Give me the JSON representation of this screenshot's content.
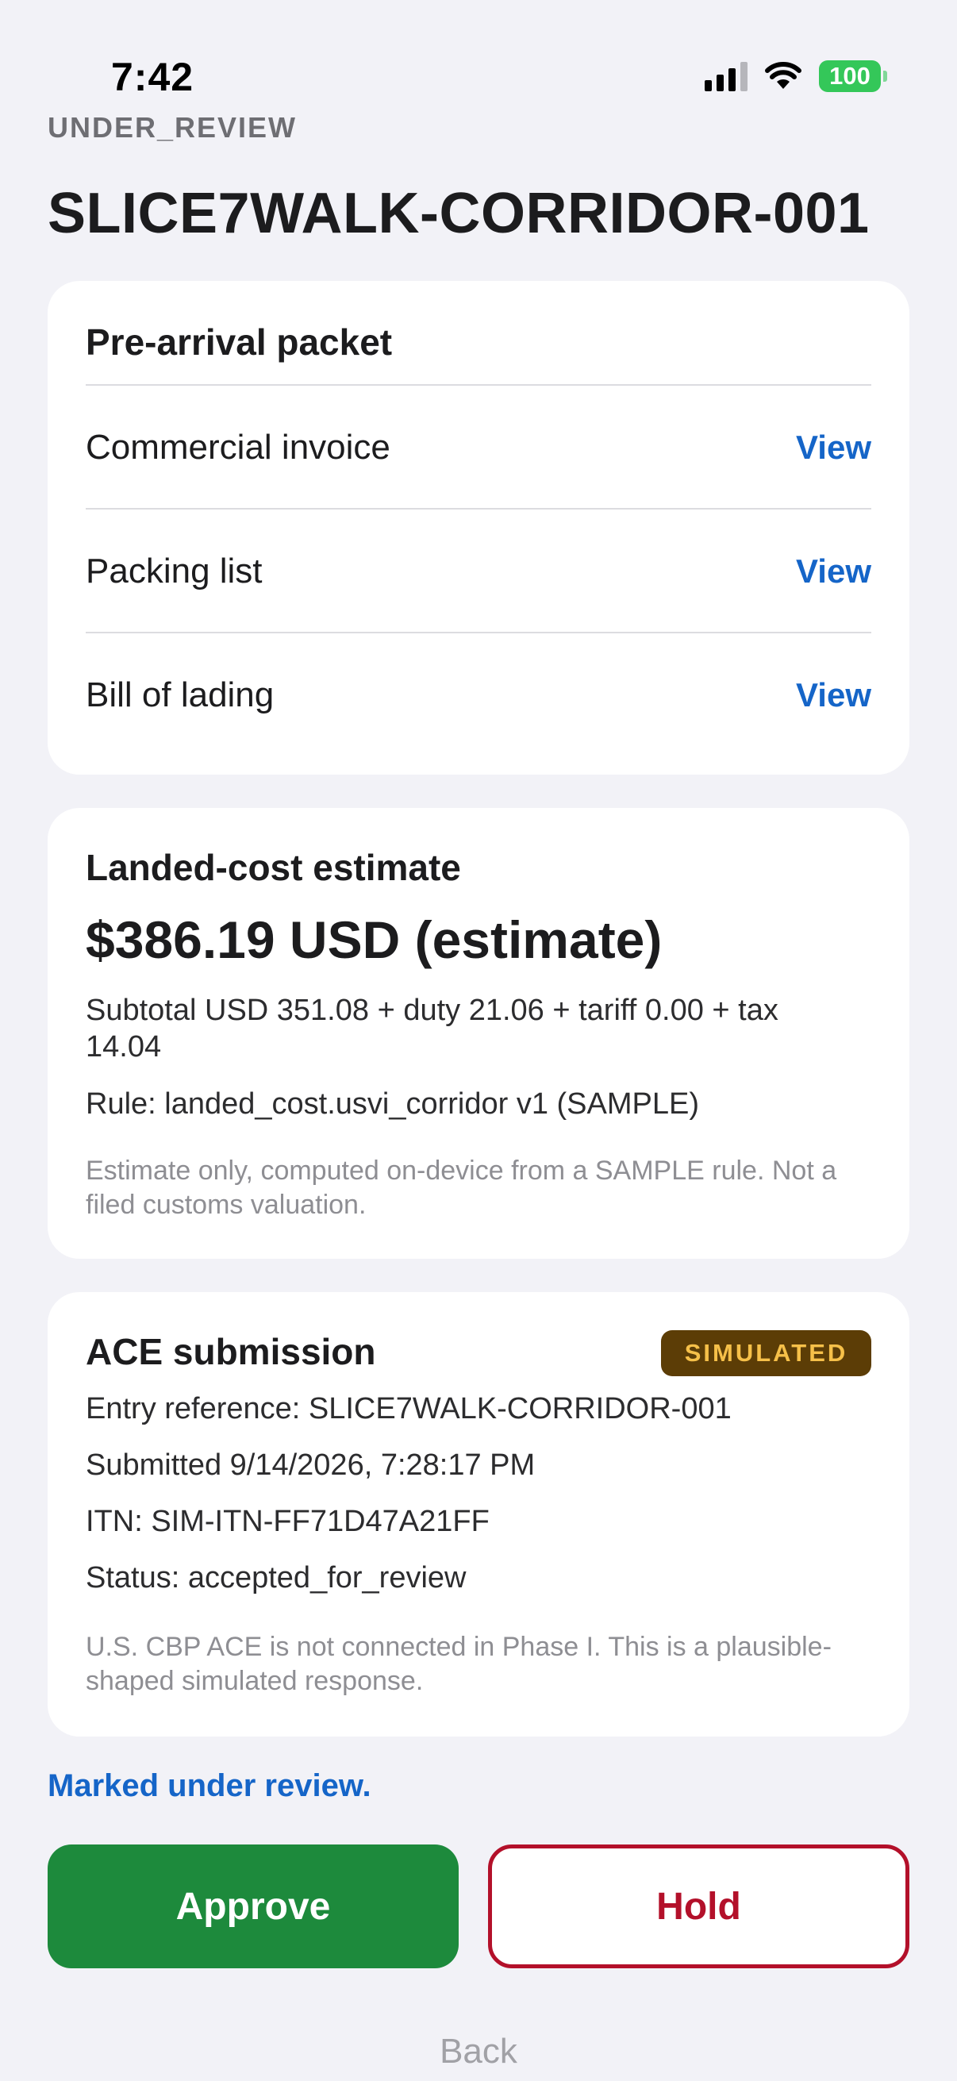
{
  "status_bar": {
    "time": "7:42",
    "battery": "100"
  },
  "header": {
    "status_label": "UNDER_REVIEW",
    "title": "SLICE7WALK-CORRIDOR-001"
  },
  "packet": {
    "title": "Pre-arrival packet",
    "view_label": "View",
    "documents": [
      {
        "label": "Commercial invoice"
      },
      {
        "label": "Packing list"
      },
      {
        "label": "Bill of lading"
      }
    ]
  },
  "landed_cost": {
    "title": "Landed-cost estimate",
    "amount": "$386.19 USD (estimate)",
    "breakdown": "Subtotal USD 351.08 + duty 21.06 + tariff 0.00 + tax 14.04",
    "rule": "Rule: landed_cost.usvi_corridor v1 (SAMPLE)",
    "note": "Estimate only, computed on-device from a SAMPLE rule. Not a filed customs valuation."
  },
  "ace": {
    "title": "ACE submission",
    "badge": "SIMULATED",
    "entry_reference": "Entry reference: SLICE7WALK-CORRIDOR-001",
    "submitted": "Submitted 9/14/2026, 7:28:17 PM",
    "itn": "ITN: SIM-ITN-FF71D47A21FF",
    "status": "Status: accepted_for_review",
    "note": "U.S. CBP ACE is not connected in Phase I. This is a plausible-shaped simulated response."
  },
  "review_message": "Marked under review.",
  "actions": {
    "approve": "Approve",
    "hold": "Hold",
    "back": "Back"
  },
  "colors": {
    "background": "#f2f2f7",
    "link_blue": "#1565c8",
    "approve_green": "#1d8a3c",
    "hold_red": "#b3102a",
    "badge_bg": "#5c3d06",
    "badge_text": "#f6c049",
    "battery_green": "#34c759"
  },
  "icons": [
    "cellular-signal-icon",
    "wifi-icon",
    "battery-icon"
  ]
}
